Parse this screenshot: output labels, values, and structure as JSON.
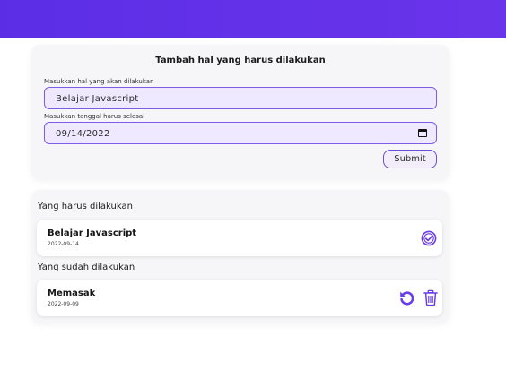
{
  "form": {
    "title": "Tambah hal yang harus dilakukan",
    "task_label": "Masukkan hal yang akan dilakukan",
    "task_value": "Belajar Javascript",
    "date_label": "Masukkan tanggal harus selesai",
    "date_value": "09/14/2022",
    "submit_label": "Submit"
  },
  "todo": {
    "heading": "Yang harus dilakukan",
    "items": [
      {
        "title": "Belajar Javascript",
        "date": "2022-09-14",
        "action_icon": "check-circle-icon"
      }
    ]
  },
  "done": {
    "heading": "Yang sudah dilakukan",
    "items": [
      {
        "title": "Memasak",
        "date": "2022-09-09",
        "action_icons": [
          "undo-icon",
          "trash-icon"
        ]
      }
    ]
  },
  "colors": {
    "header": "#5b2ee6",
    "accent": "#6a3de8",
    "input_bg": "#efe9ff",
    "card_bg": "#f6f6f8"
  }
}
